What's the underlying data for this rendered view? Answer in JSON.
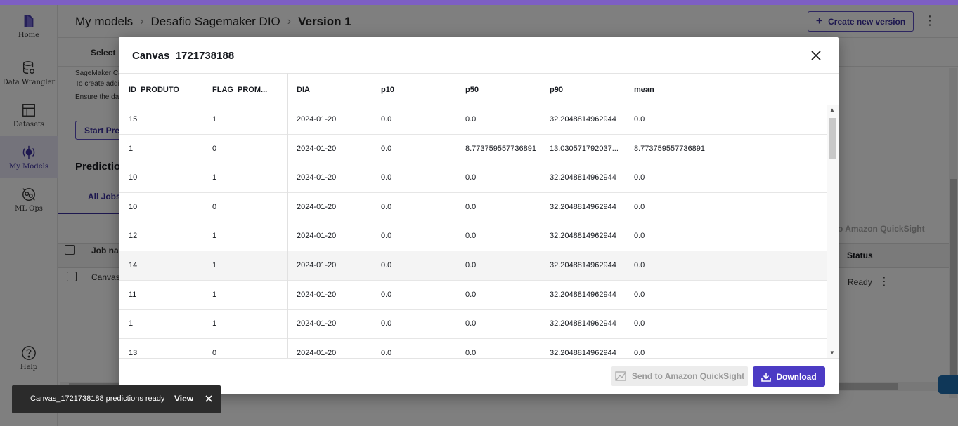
{
  "sidebar": {
    "items": [
      {
        "label": "Home",
        "icon": "home-icon"
      },
      {
        "label": "Data Wrangler",
        "icon": "database-icon"
      },
      {
        "label": "Datasets",
        "icon": "table-icon"
      },
      {
        "label": "My Models",
        "icon": "model-icon",
        "active": true
      },
      {
        "label": "ML Ops",
        "icon": "mlops-icon"
      },
      {
        "label": "Help",
        "icon": "help-icon"
      }
    ]
  },
  "header": {
    "breadcrumb": [
      "My models",
      "Desafio Sagemaker DIO",
      "Version 1"
    ],
    "create_label": "Create new version"
  },
  "background": {
    "tab_select": "Select",
    "line1": "SageMaker Ca",
    "line2": "To create addi",
    "line3": "Ensure the dat",
    "start_btn": "Start Pred",
    "predictions_title": "Prediction",
    "all_jobs": "All Jobs",
    "qs_text": "to Amazon QuickSight",
    "job_name_header": "Job nar",
    "job_name_value": "Canvas_",
    "status_header": "Status",
    "status_value": "Ready"
  },
  "modal": {
    "title": "Canvas_1721738188",
    "columns": [
      "ID_PRODUTO",
      "FLAG_PROM...",
      "DIA",
      "p10",
      "p50",
      "p90",
      "mean"
    ],
    "rows": [
      [
        "15",
        "1",
        "2024-01-20",
        "0.0",
        "0.0",
        "32.2048814962944",
        "0.0"
      ],
      [
        "1",
        "0",
        "2024-01-20",
        "0.0",
        "8.773759557736891",
        "13.030571792037...",
        "8.773759557736891"
      ],
      [
        "10",
        "1",
        "2024-01-20",
        "0.0",
        "0.0",
        "32.2048814962944",
        "0.0"
      ],
      [
        "10",
        "0",
        "2024-01-20",
        "0.0",
        "0.0",
        "32.2048814962944",
        "0.0"
      ],
      [
        "12",
        "1",
        "2024-01-20",
        "0.0",
        "0.0",
        "32.2048814962944",
        "0.0"
      ],
      [
        "14",
        "1",
        "2024-01-20",
        "0.0",
        "0.0",
        "32.2048814962944",
        "0.0"
      ],
      [
        "11",
        "1",
        "2024-01-20",
        "0.0",
        "0.0",
        "32.2048814962944",
        "0.0"
      ],
      [
        "1",
        "1",
        "2024-01-20",
        "0.0",
        "0.0",
        "32.2048814962944",
        "0.0"
      ],
      [
        "13",
        "0",
        "2024-01-20",
        "0.0",
        "0.0",
        "32.2048814962944",
        "0.0"
      ]
    ],
    "highlighted_row": 5,
    "send_quicksight_label": "Send to Amazon QuickSight",
    "download_label": "Download"
  },
  "toast": {
    "message": "Canvas_1721738188 predictions ready",
    "action": "View"
  },
  "colors": {
    "accent": "#4c3bc4",
    "accent_text": "#3b2f9e",
    "top_stripe": "#7d5fc4"
  }
}
